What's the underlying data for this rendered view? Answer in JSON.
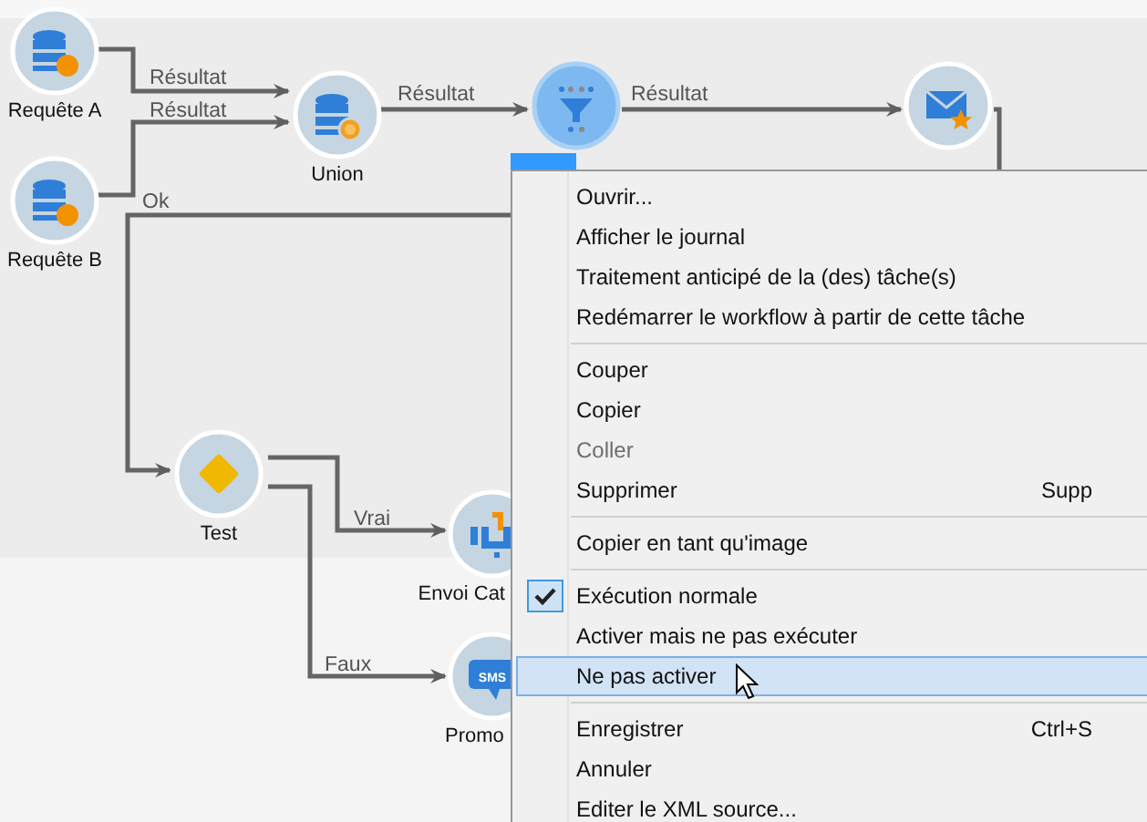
{
  "nodes": [
    {
      "label": "Requête A",
      "kind": "database",
      "selected": false
    },
    {
      "label": "Requête B",
      "kind": "database",
      "selected": false
    },
    {
      "label": "Union",
      "kind": "union",
      "selected": false
    },
    {
      "kind": "dedup",
      "selected": true
    },
    {
      "kind": "email",
      "selected": false
    },
    {
      "label": "Test",
      "kind": "test",
      "selected": false
    },
    {
      "label": "Envoi Cat",
      "kind": "delivery",
      "selected": false
    },
    {
      "label": "Promo",
      "kind": "sms",
      "icon_text": "SMS",
      "selected": false
    }
  ],
  "edges": [
    {
      "label": "Résultat",
      "kind": "arrow"
    },
    {
      "label": "Résultat",
      "kind": "arrow"
    },
    {
      "label": "Résultat",
      "kind": "arrow"
    },
    {
      "label": "Résultat",
      "kind": "arrow"
    },
    {
      "kind": "line"
    },
    {
      "label": "Ok",
      "kind": "arrow"
    },
    {
      "label": "Vrai",
      "kind": "arrow"
    },
    {
      "label": "Faux",
      "kind": "arrow"
    }
  ],
  "context_menu": [
    {
      "kind": "item",
      "label": "Ouvrir...",
      "disabled": false,
      "checked": false,
      "selected": false
    },
    {
      "kind": "item",
      "label": "Afficher le journal",
      "disabled": false,
      "checked": false,
      "selected": false
    },
    {
      "kind": "item",
      "label": "Traitement anticipé de la (des) tâche(s)",
      "disabled": false,
      "checked": false,
      "selected": false
    },
    {
      "kind": "item",
      "label": "Redémarrer le workflow à partir de cette tâche",
      "disabled": false,
      "checked": false,
      "selected": false
    },
    {
      "kind": "separator"
    },
    {
      "kind": "item",
      "label": "Couper",
      "disabled": false,
      "checked": false,
      "selected": false
    },
    {
      "kind": "item",
      "label": "Copier",
      "disabled": false,
      "checked": false,
      "selected": false
    },
    {
      "kind": "item",
      "label": "Coller",
      "disabled": true,
      "checked": false,
      "selected": false
    },
    {
      "kind": "item",
      "label": "Supprimer",
      "shortcut": "Supp",
      "disabled": false,
      "checked": false,
      "selected": false
    },
    {
      "kind": "separator"
    },
    {
      "kind": "item",
      "label": "Copier en tant qu'image",
      "disabled": false,
      "checked": false,
      "selected": false
    },
    {
      "kind": "separator"
    },
    {
      "kind": "item",
      "label": "Exécution normale",
      "disabled": false,
      "checked": true,
      "selected": false
    },
    {
      "kind": "item",
      "label": "Activer mais ne pas exécuter",
      "disabled": false,
      "checked": false,
      "selected": false
    },
    {
      "kind": "item",
      "label": "Ne pas activer",
      "disabled": false,
      "checked": false,
      "selected": true
    },
    {
      "kind": "separator"
    },
    {
      "kind": "item",
      "label": "Enregistrer",
      "shortcut": "Ctrl+S",
      "disabled": false,
      "checked": false,
      "selected": false
    },
    {
      "kind": "item",
      "label": "Annuler",
      "disabled": false,
      "checked": false,
      "selected": false
    },
    {
      "kind": "item",
      "label": "Editer le XML source...",
      "disabled": false,
      "checked": false,
      "selected": false
    }
  ]
}
